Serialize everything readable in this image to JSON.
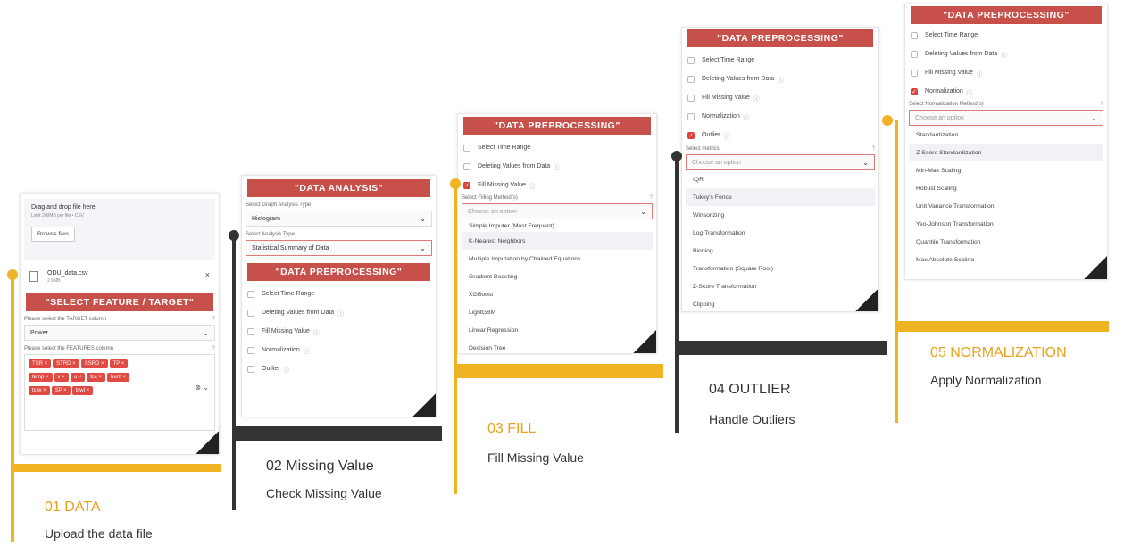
{
  "top_title": "",
  "panel1": {
    "upload_title": "Drag and drop file here",
    "upload_limit": "Limit 200MB per file • CSV",
    "browse_label": "Browse files",
    "file_name": "ODU_data.csv",
    "file_size": "2.6MB",
    "close_glyph": "×",
    "banner": "\"SELECT FEATURE / TARGET\"",
    "target_label": "Please select the TARGET column",
    "target_value": "Power",
    "features_label": "Please select the FEATURES column",
    "features": [
      "TSR ×",
      "STRD ×",
      "SSRD ×",
      "TP ×",
      "temp ×",
      "v ×",
      "u ×",
      "tcc ×",
      "hum ×",
      "tclw ×",
      "SP ×",
      "tcwl ×"
    ]
  },
  "panel2": {
    "banner_analysis": "\"DATA ANALYSIS\"",
    "graph_label": "Select Graph Analysis Type",
    "graph_value": "Histogram",
    "analysis_label": "Select Analysis Type",
    "analysis_value": "Statistical Summary of Data",
    "banner_pre": "\"DATA PREPROCESSING\"",
    "checks": [
      "Select Time Range",
      "Deleting Values from Data",
      "Fill Missing Value",
      "Normalization",
      "Outlier"
    ]
  },
  "panel3": {
    "banner": "\"DATA PREPROCESSING\"",
    "checks": [
      "Select Time Range",
      "Deleting Values from Data",
      "Fill Missing Value"
    ],
    "method_label": "Select Filling Method(s)",
    "placeholder": "Choose an option",
    "options": [
      "Simple Imputer (Most Frequent)",
      "K-Nearest Neighbors",
      "Multiple Imputation by Chained Equations",
      "Gradient Boosting",
      "XGBoost",
      "LightGBM",
      "Linear Regression",
      "Decision Tree"
    ]
  },
  "panel4": {
    "banner": "\"DATA PREPROCESSING\"",
    "checks": [
      "Select Time Range",
      "Deleting Values from Data",
      "Fill Missing Value",
      "Normalization",
      "Outlier"
    ],
    "metrics_label": "Select metrics",
    "placeholder": "Choose an option",
    "options": [
      "IQR",
      "Tukey's Fence",
      "Winsorizing",
      "Log Transformation",
      "Binning",
      "Transformation (Square Root)",
      "Z-Score Transformation",
      "Clipping"
    ]
  },
  "panel5": {
    "banner": "\"DATA PREPROCESSING\"",
    "checks": [
      "Select Time Range",
      "Deleting Values from Data",
      "Fill Missing Value",
      "Normalization"
    ],
    "method_label": "Select Normalization Method(s)",
    "placeholder": "Choose an option",
    "options": [
      "Standardization",
      "Z-Score Standardization",
      "Min-Max Scaling",
      "Robust Scaling",
      "Unit Variance Transformation",
      "Yeo-Johnson Transformation",
      "Quantile Transformation",
      "Max Absolute Scaling"
    ]
  },
  "steps": [
    {
      "title": "01 DATA",
      "subtitle": "Upload the data file",
      "color": "#f0b323"
    },
    {
      "title": "02 Missing Value",
      "subtitle": "Check Missing Value",
      "color": "#333333"
    },
    {
      "title": "03 FILL",
      "subtitle": "Fill Missing Value",
      "color": "#f0b323"
    },
    {
      "title": "04 OUTLIER",
      "subtitle": "Handle Outliers",
      "color": "#333333"
    },
    {
      "title": "05 NORMALIZATION",
      "subtitle": "Apply Normalization",
      "color": "#f0b323"
    }
  ]
}
